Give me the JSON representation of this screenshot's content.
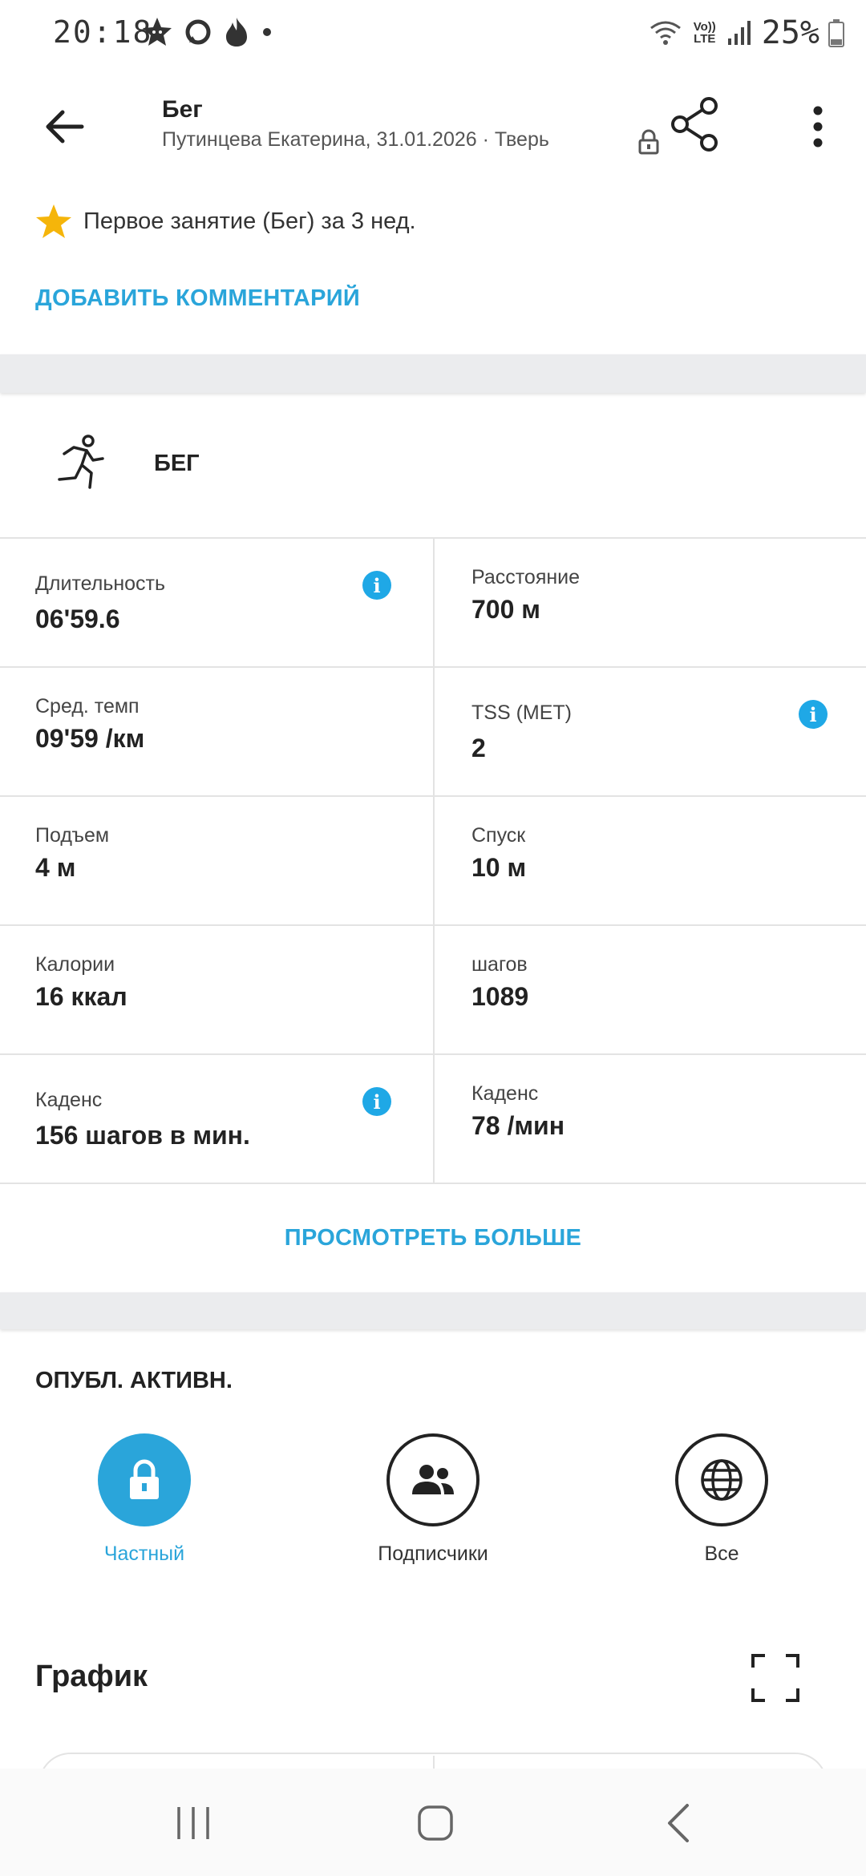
{
  "status_bar": {
    "time": "20:18",
    "battery_percent": "25%",
    "network": "Vo)) LTE"
  },
  "header": {
    "title": "Бег",
    "subtitle": "Путинцева Екатерина, 31.01.2026 · Тверь",
    "icons": [
      "back-arrow-icon",
      "lock-icon",
      "share-icon",
      "more-vertical-icon"
    ]
  },
  "achievement": {
    "icon": "star-icon",
    "text": "Первое занятие (Бег) за 3 нед."
  },
  "add_comment_label": "ДОБАВИТЬ КОММЕНТАРИЙ",
  "activity": {
    "icon": "running-person-icon",
    "label": "БЕГ"
  },
  "stats": [
    {
      "label": "Длительность",
      "value": "06'59.6",
      "info": true
    },
    {
      "label": "Расстояние",
      "value": "700 м",
      "info": false
    },
    {
      "label": "Сред. темп",
      "value": "09'59 /км",
      "info": false
    },
    {
      "label": "TSS (MET)",
      "value": "2",
      "info": true
    },
    {
      "label": "Подъем",
      "value": "4 м",
      "info": false
    },
    {
      "label": "Спуск",
      "value": "10 м",
      "info": false
    },
    {
      "label": "Калории",
      "value": "16 ккал",
      "info": false
    },
    {
      "label": "шагов",
      "value": "1089",
      "info": false
    },
    {
      "label": "Каденс",
      "value": "156 шагов в мин.",
      "info": true
    },
    {
      "label": "Каденс",
      "value": "78 /мин",
      "info": false
    }
  ],
  "info_glyph": "i",
  "see_more_label": "ПРОСМОТРЕТЬ БОЛЬШЕ",
  "publish": {
    "title": "ОПУБЛ. АКТИВН.",
    "options": [
      {
        "label": "Частный",
        "icon": "lock-icon",
        "selected": true
      },
      {
        "label": "Подписчики",
        "icon": "people-icon",
        "selected": false
      },
      {
        "label": "Все",
        "icon": "globe-icon",
        "selected": false
      }
    ]
  },
  "graph": {
    "title": "График",
    "icon": "fullscreen-icon"
  },
  "colors": {
    "accent": "#2AA5DA",
    "info": "#1FA8E6",
    "star": "#F5B50A",
    "divider": "#E3E3E3",
    "band": "#EBECEE"
  }
}
